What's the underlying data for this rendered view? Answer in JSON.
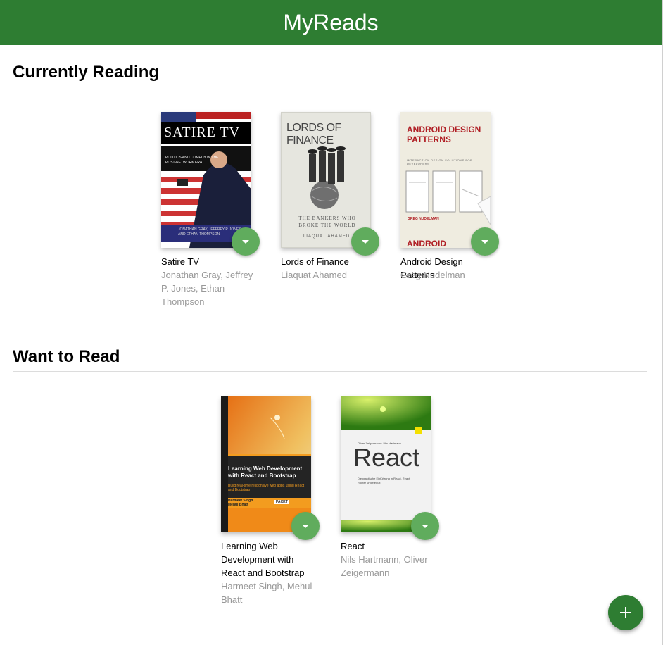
{
  "app": {
    "title": "MyReads"
  },
  "shelves": {
    "current": {
      "title": "Currently Reading",
      "books": [
        {
          "title": "Satire TV",
          "authors": "Jonathan Gray, Jeffrey P. Jones, Ethan Thompson",
          "cover_text": {
            "title": "SATIRE TV",
            "subtitle": "POLITICS AND COMEDY IN THE POST-NETWORK ERA",
            "credit": "JONATHAN GRAY, JEFFREY P. JONES, AND ETHAN THOMPSON"
          }
        },
        {
          "title": "Lords of Finance",
          "authors": "Liaquat Ahamed",
          "cover_text": {
            "title": "LORDS OF FINANCE",
            "subtitle": "THE BANKERS WHO BROKE THE WORLD",
            "credit": "LIAQUAT AHAMED"
          }
        },
        {
          "title": "Android Design Patterns",
          "authors": "Greg Nudelman",
          "cover_text": {
            "title": "ANDROID DESIGN PATTERNS",
            "subtitle": "INTERACTION DESIGN SOLUTIONS FOR DEVELOPERS",
            "credit": "GREG NUDELMAN",
            "footer": "ANDROID"
          }
        }
      ]
    },
    "want": {
      "title": "Want to Read",
      "books": [
        {
          "title": "Learning Web Development with React and Bootstrap",
          "authors": "Harmeet Singh, Mehul Bhatt",
          "cover_text": {
            "title": "Learning Web Development with React and Bootstrap",
            "subtitle": "Build real-time responsive web apps using React and Bootstrap",
            "credit": "Harmeet Singh Mehul Bhatt",
            "publisher": "PACKT"
          }
        },
        {
          "title": "React",
          "authors": "Nils Hartmann, Oliver Zeigermann",
          "cover_text": {
            "title": "React",
            "credit": "Oliver Zeigermann · Nils Hartmann",
            "subtitle": "Die praktische Einführung in React, React Router und Redux"
          }
        }
      ]
    }
  },
  "colors": {
    "header": "#2e7d32",
    "changer": "#60ac5d",
    "fab": "#2e7d32"
  },
  "icons": {
    "changer": "triangle-down-icon",
    "add": "plus-icon"
  }
}
